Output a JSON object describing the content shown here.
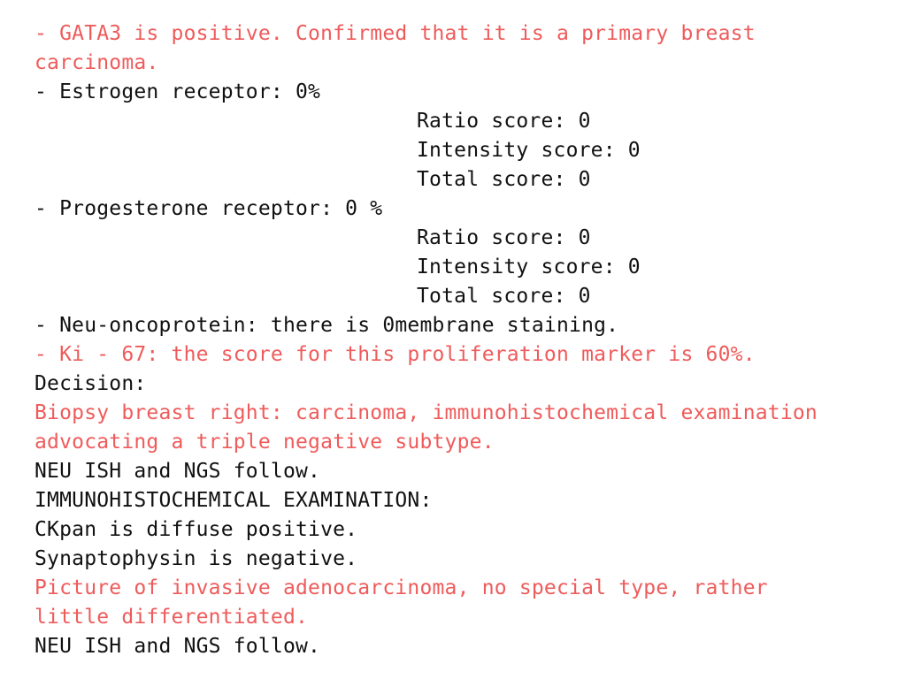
{
  "colors": {
    "highlight": "#ef5b5b",
    "text": "#111111",
    "background": "#ffffff"
  },
  "lines": {
    "gata3_1": "- GATA3 is positive. Confirmed that it is a primary breast",
    "gata3_2": "carcinoma.",
    "er_header": "- Estrogen receptor: 0%",
    "er_ratio": "Ratio score: 0",
    "er_intensity": "Intensity score: 0",
    "er_total": "Total score: 0",
    "pr_header": "- Progesterone receptor: 0 %",
    "pr_ratio": "Ratio score: 0",
    "pr_intensity": "Intensity score: 0",
    "pr_total": "Total score: 0",
    "neu": "- Neu-oncoprotein: there is 0membrane staining.",
    "ki67": "- Ki - 67: the score for this proliferation marker is 60%.",
    "decision": "Decision:",
    "biopsy_1": "Biopsy breast right: carcinoma, immunohistochemical examination",
    "biopsy_2": "advocating a triple negative subtype.",
    "followup_1": "NEU ISH and NGS follow.",
    "ihc_heading": "IMMUNOHISTOCHEMICAL EXAMINATION:",
    "ckpan": "CKpan is diffuse positive.",
    "synapto": "Synaptophysin is negative.",
    "picture_1": "Picture of invasive adenocarcinoma, no special type, rather",
    "picture_2": "little differentiated.",
    "followup_2": "NEU ISH and NGS follow."
  }
}
